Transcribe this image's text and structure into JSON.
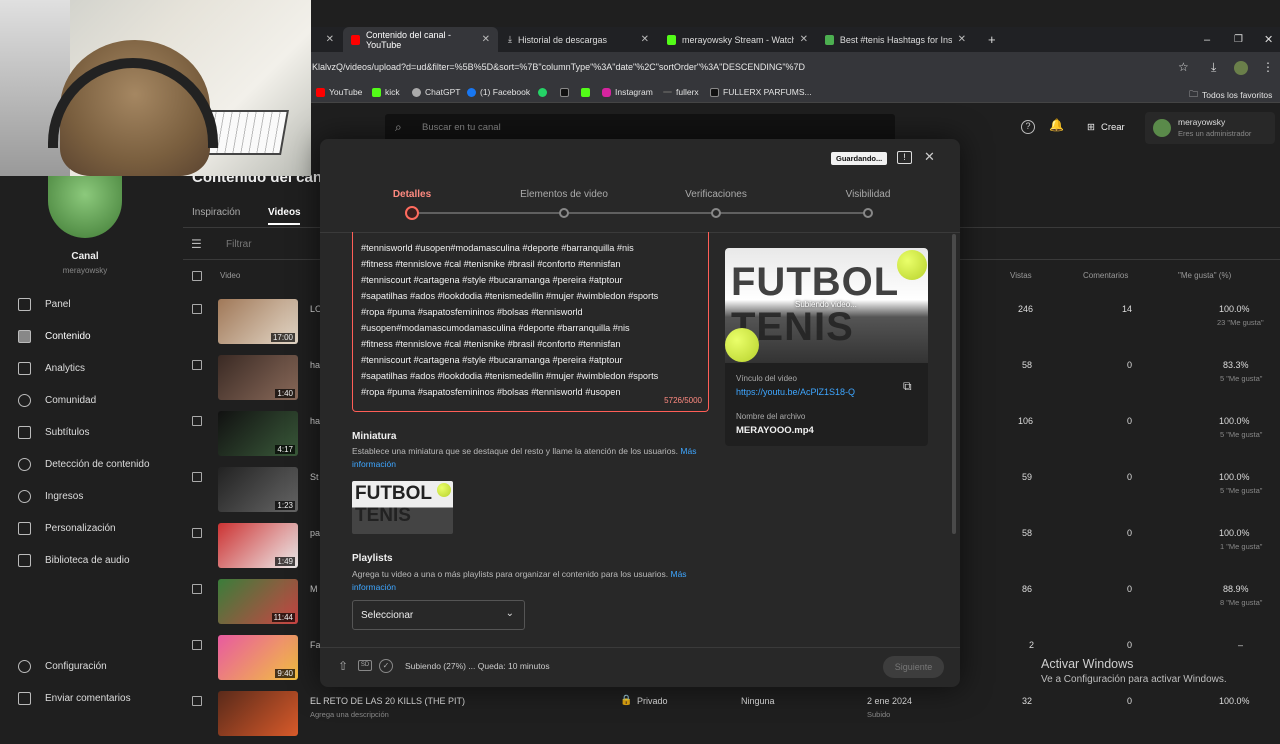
{
  "browser": {
    "tabs": [
      {
        "label": "Contenido del canal - YouTube",
        "active": true
      },
      {
        "label": "Historial de descargas"
      },
      {
        "label": "merayowsky Stream - Watch Li"
      },
      {
        "label": "Best #tenis Hashtags for Instag"
      }
    ],
    "url": "KlalvzQ/videos/upload?d=ud&filter=%5B%5D&sort=%7B\"columnType\"%3A\"date\"%2C\"sortOrder\"%3A\"DESCENDING\"%7D",
    "bookmarks": [
      "YouTube",
      "kick",
      "ChatGPT",
      "(1) Facebook",
      "Instagram",
      "fullerx",
      "FULLERX PARFUMS...",
      "Todos los favoritos"
    ]
  },
  "studio": {
    "search_placeholder": "Buscar en tu canal",
    "create_label": "Crear",
    "account_name": "merayowsky",
    "account_role": "Eres un administrador",
    "page_title": "Contenido del canal",
    "tabs": [
      "Inspiración",
      "Videos"
    ],
    "filter_label": "Filtrar",
    "channel_label": "Canal",
    "channel_handle": "merayowsky",
    "sidebar": [
      "Panel",
      "Contenido",
      "Analytics",
      "Comunidad",
      "Subtítulos",
      "Detección de contenido",
      "Ingresos",
      "Personalización",
      "Biblioteca de audio"
    ],
    "sidebar_bottom": [
      "Configuración",
      "Enviar comentarios"
    ],
    "columns": {
      "video": "Video",
      "views": "Vistas",
      "comments": "Comentarios",
      "likes": "\"Me gusta\" (%)"
    },
    "rows": [
      {
        "title": "LO",
        "duration": "17:00",
        "views": "246",
        "comments": "14",
        "likes": "100.0%",
        "likes_sub": "23 \"Me gusta\""
      },
      {
        "title": "ha",
        "duration": "1:40",
        "views": "58",
        "comments": "0",
        "likes": "83.3%",
        "likes_sub": "5 \"Me gusta\""
      },
      {
        "title": "ha",
        "duration": "4:17",
        "views": "106",
        "comments": "0",
        "likes": "100.0%",
        "likes_sub": "5 \"Me gusta\""
      },
      {
        "title": "St",
        "duration": "1:23",
        "views": "59",
        "comments": "0",
        "likes": "100.0%",
        "likes_sub": "5 \"Me gusta\""
      },
      {
        "title": "pa",
        "duration": "1:49",
        "views": "58",
        "comments": "0",
        "likes": "100.0%",
        "likes_sub": "1 \"Me gusta\""
      },
      {
        "title": "M",
        "duration": "11:44",
        "views": "86",
        "comments": "0",
        "likes": "88.9%",
        "likes_sub": "8 \"Me gusta\""
      },
      {
        "title": "Fa",
        "duration": "9:40",
        "views": "2",
        "comments": "0",
        "likes": "–",
        "likes_sub": ""
      },
      {
        "title": "EL RETO DE LAS 20 KILLS (THE PIT)",
        "subtitle": "Agrega una descripción",
        "visibility": "Privado",
        "restrictions": "Ninguna",
        "date": "2 ene 2024",
        "date_sub": "Subido",
        "views": "32",
        "comments": "0",
        "likes": "100.0%"
      }
    ]
  },
  "modal": {
    "saving_badge": "Guardando...",
    "steps": [
      "Detalles",
      "Elementos de video",
      "Verificaciones",
      "Visibilidad"
    ],
    "description": "#tennisworld #usopen#modamasculina #deporte #barranquilla #nis\n#fitness #tennislove #cal #tenisnike #brasil #conforto #tennisfan\n#tenniscourt #cartagena #style #bucaramanga #pereira #atptour\n#sapatilhas #ados #lookdodia #tenismedellin #mujer #wimbledon #sports\n#ropa #puma #sapatosfemininos #bolsas #tennisworld\n#usopen#modamascumodamasculina #deporte #barranquilla #nis\n#fitness #tennislove #cal #tenisnike #brasil #conforto #tennisfan\n#tenniscourt #cartagena #style #bucaramanga #pereira #atptour\n#sapatilhas #ados #lookdodia #tenismedellin #mujer #wimbledon #sports\n#ropa #puma #sapatosfemininos #bolsas #tennisworld #usopen",
    "char_count": "5726/5000",
    "thumbnail_title": "Miniatura",
    "thumbnail_text": "Establece una miniatura que se destaque del resto y llame la atención de los usuarios.",
    "more_info": "Más información",
    "playlists_title": "Playlists",
    "playlists_text": "Agrega tu video a una o más playlists para organizar el contenido para los usuarios.",
    "select_label": "Seleccionar",
    "preview_text": "FUTBOL TENIS",
    "uploading_overlay": "Subiendo video...",
    "video_link_label": "Vínculo del video",
    "video_link": "https://youtu.be/AcPlZ1S18-Q",
    "filename_label": "Nombre del archivo",
    "filename": "MERAYOOO.mp4",
    "upload_status": "Subiendo (27%) ... Queda: 10 minutos",
    "next_label": "Siguiente",
    "upload_progress": 0.27
  },
  "windows_watermark": {
    "title": "Activar Windows",
    "text": "Ve a Configuración para activar Windows."
  }
}
